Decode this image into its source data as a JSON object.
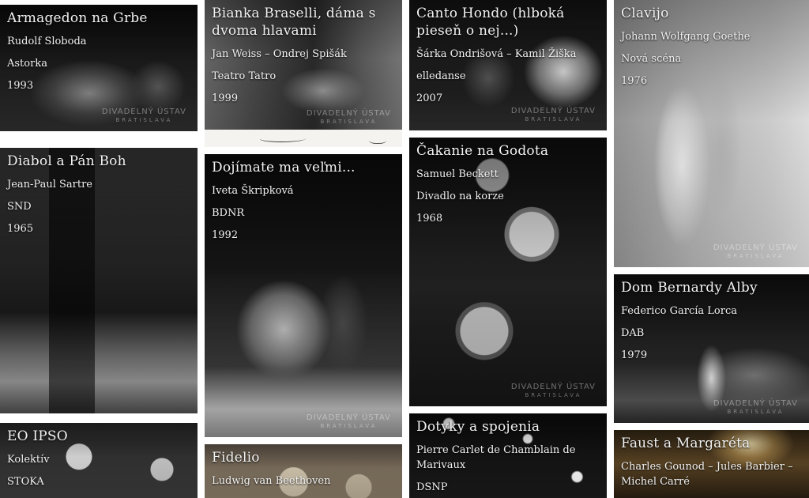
{
  "watermark": {
    "line1": "DIVADELNÝ ÚSTAV",
    "line2": "BRATISLAVA"
  },
  "tiles": [
    {
      "title": "Armagedon na Grbe",
      "lines": [
        "Rudolf Sloboda",
        "Astorka",
        "1993"
      ]
    },
    {
      "title": "Bianka Braselli, dáma s dvoma hlavami",
      "lines": [
        "Jan Weiss – Ondrej Spišák",
        "Teatro Tatro",
        "1999"
      ]
    },
    {
      "title": "Canto Hondo (hlboká pieseň o nej...)",
      "lines": [
        "Šárka Ondrišová – Kamil Žiška",
        "elledanse",
        "2007"
      ]
    },
    {
      "title": "Clavijo",
      "lines": [
        "Johann Wolfgang Goethe",
        "Nová scéna",
        "1976"
      ]
    },
    {
      "title": "Diabol a Pán Boh",
      "lines": [
        "Jean-Paul Sartre",
        "SND",
        "1965"
      ]
    },
    {
      "title": "Dojímate ma veľmi...",
      "lines": [
        "Iveta Škripková",
        "BDNR",
        "1992"
      ]
    },
    {
      "title": "Čakanie na Godota",
      "lines": [
        "Samuel Beckett",
        "Divadlo na korze",
        "1968"
      ]
    },
    {
      "title": "Dom Bernardy Alby",
      "lines": [
        "Federico García Lorca",
        "DAB",
        "1979"
      ]
    },
    {
      "title": "EO IPSO",
      "lines": [
        "Kolektív",
        "STOKA"
      ]
    },
    {
      "title": "Fidelio",
      "lines": [
        "Ludwig van Beethoven"
      ]
    },
    {
      "title": "Dotyky a spojenia",
      "lines": [
        "Pierre Carlet de Chamblain de Marivaux",
        "DSNP"
      ]
    },
    {
      "title": "Faust a Margaréta",
      "lines": [
        "Charles Gounod – Jules Barbier – Michel Carré"
      ]
    }
  ]
}
